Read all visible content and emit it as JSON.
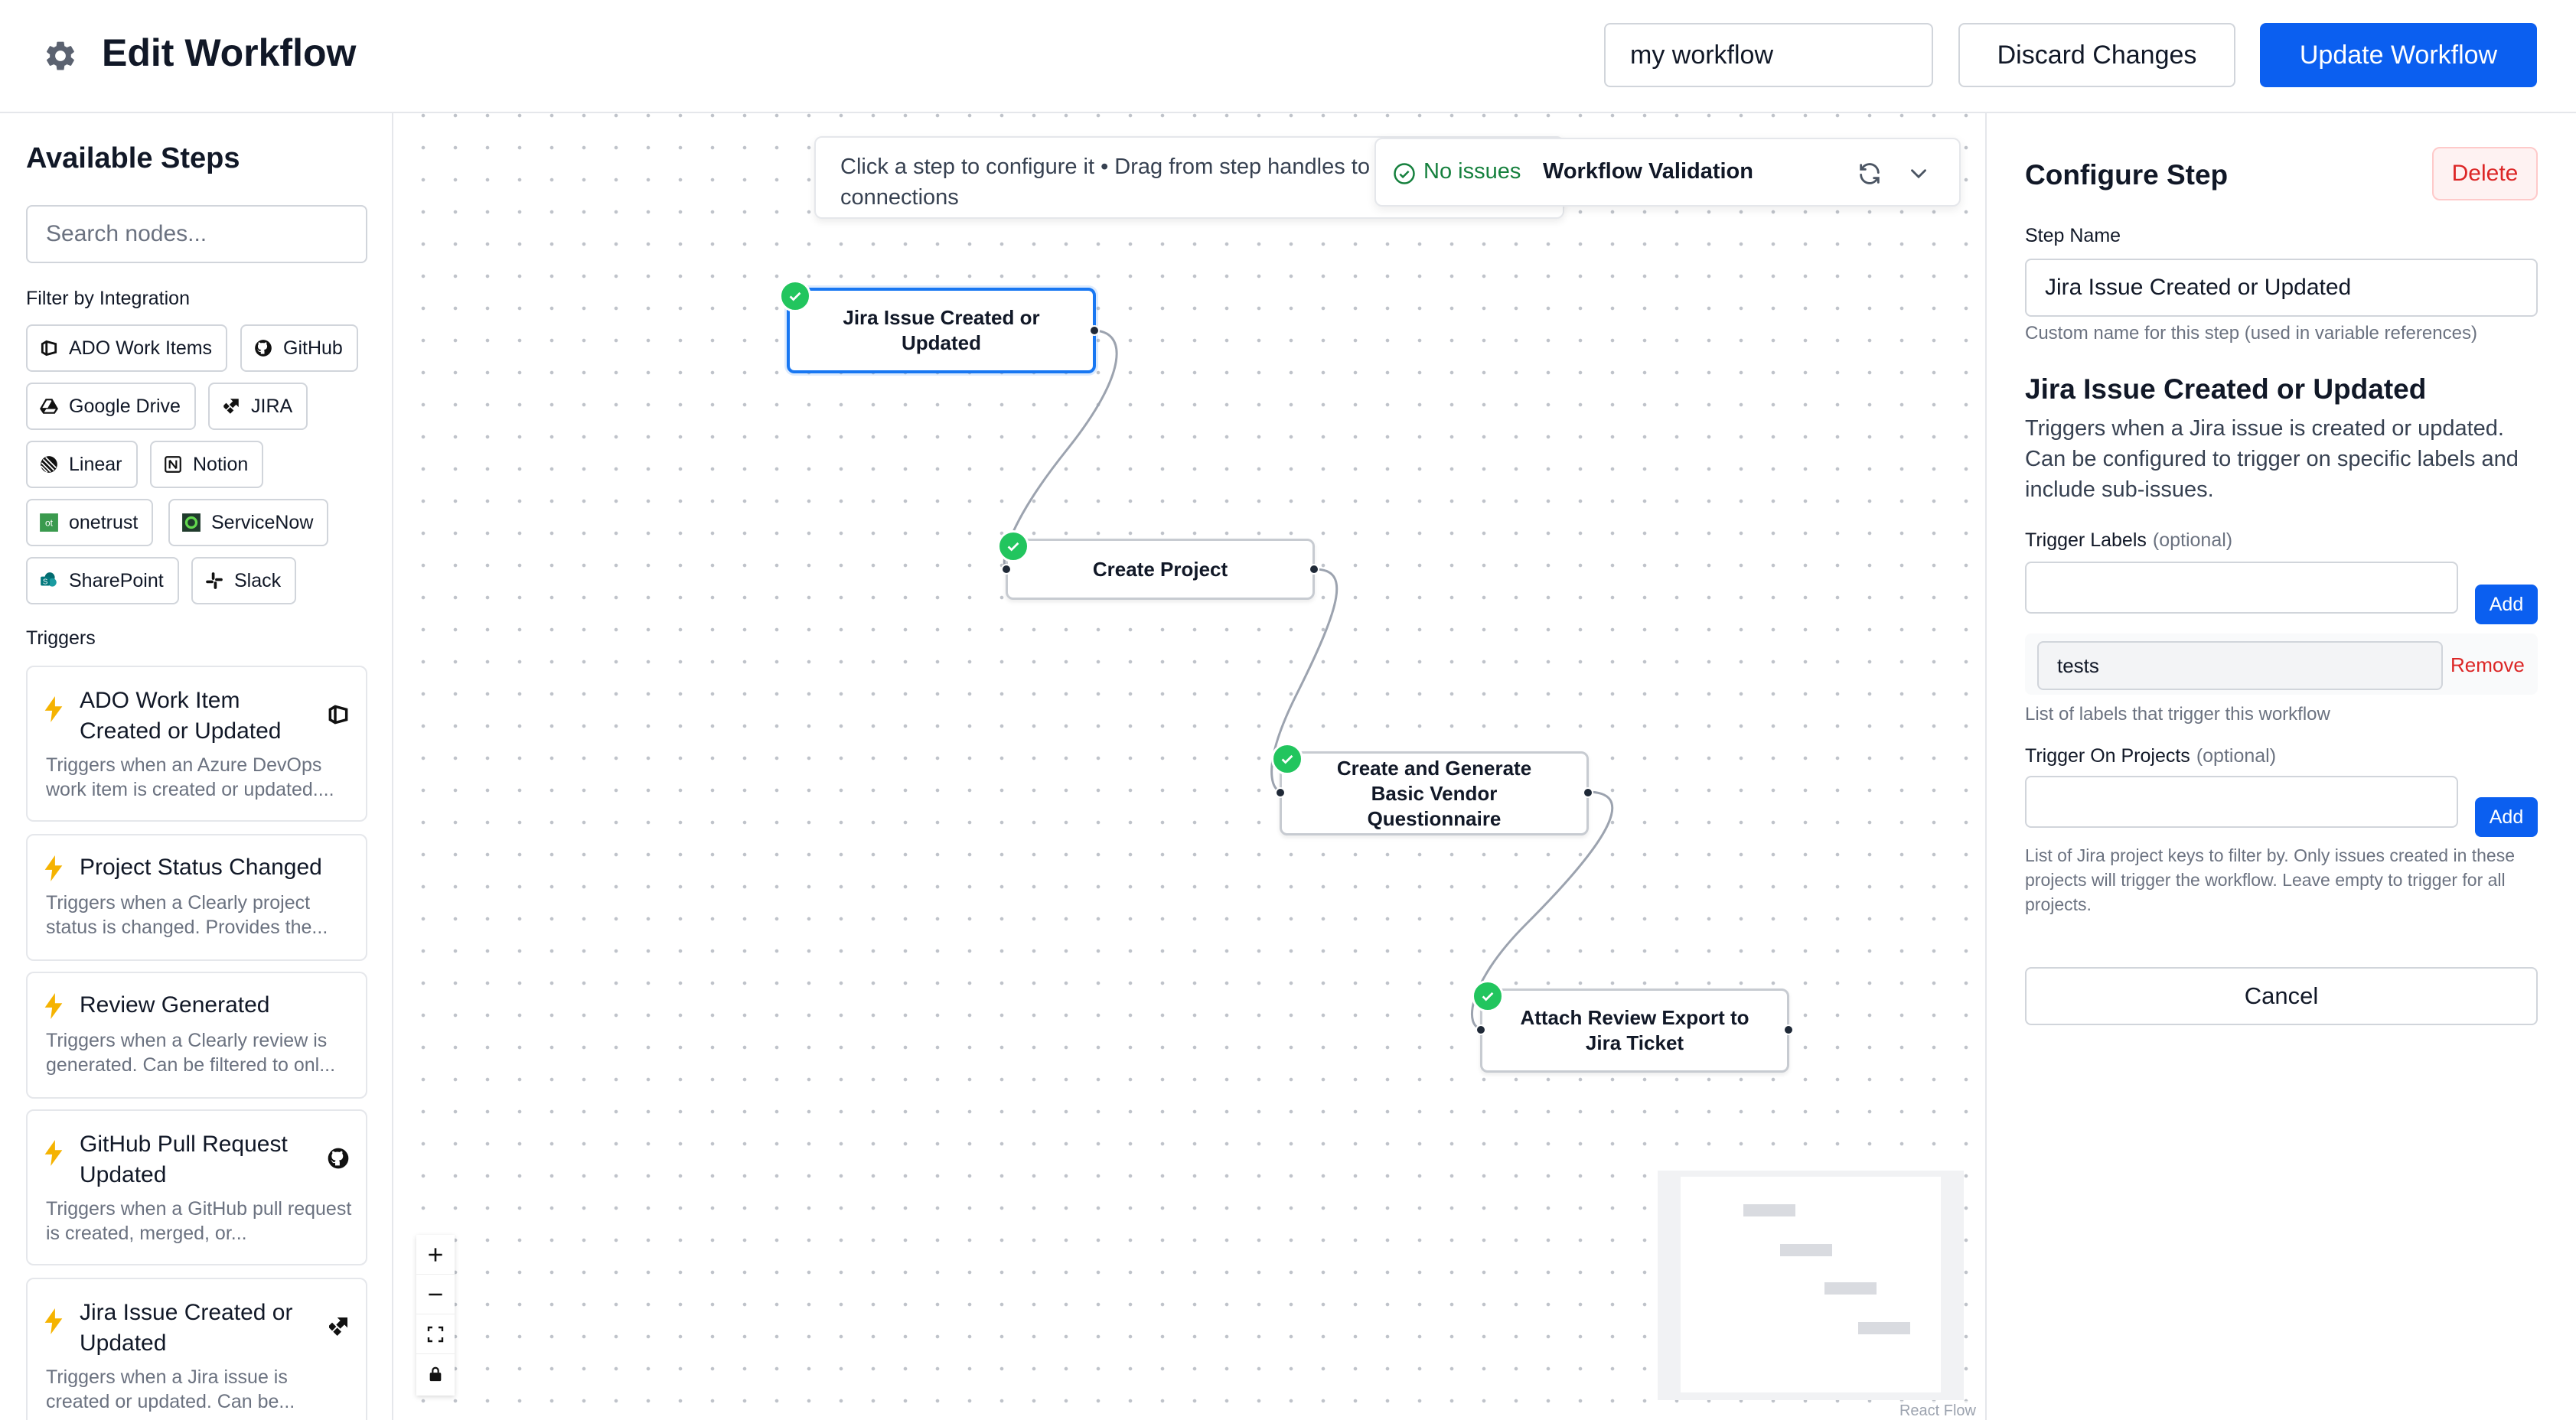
{
  "header": {
    "title": "Edit Workflow",
    "workflow_name": "my workflow",
    "discard_label": "Discard Changes",
    "update_label": "Update Workflow",
    "icon": "gear-icon"
  },
  "sidebar": {
    "title": "Available Steps",
    "search_placeholder": "Search nodes...",
    "filter_label": "Filter by Integration",
    "integrations": [
      {
        "label": "ADO Work Items",
        "icon": "azure-devops-icon"
      },
      {
        "label": "GitHub",
        "icon": "github-icon"
      },
      {
        "label": "Google Drive",
        "icon": "google-drive-icon"
      },
      {
        "label": "JIRA",
        "icon": "jira-icon"
      },
      {
        "label": "Linear",
        "icon": "linear-icon"
      },
      {
        "label": "Notion",
        "icon": "notion-icon"
      },
      {
        "label": "onetrust",
        "icon": "onetrust-icon"
      },
      {
        "label": "ServiceNow",
        "icon": "servicenow-icon"
      },
      {
        "label": "SharePoint",
        "icon": "sharepoint-icon"
      },
      {
        "label": "Slack",
        "icon": "slack-icon"
      }
    ],
    "triggers_label": "Triggers",
    "triggers": [
      {
        "title": "ADO Work Item Created or Updated",
        "desc": "Triggers when an Azure DevOps work item is created or updated....",
        "icon": "azure-devops-icon"
      },
      {
        "title": "Project Status Changed",
        "desc": "Triggers when a Clearly project status is changed. Provides the...",
        "icon": ""
      },
      {
        "title": "Review Generated",
        "desc": "Triggers when a Clearly review is generated. Can be filtered to onl...",
        "icon": ""
      },
      {
        "title": "GitHub Pull Request Updated",
        "desc": "Triggers when a GitHub pull request is created, merged, or...",
        "icon": "github-icon"
      },
      {
        "title": "Jira Issue Created or Updated",
        "desc": "Triggers when a Jira issue is created or updated. Can be...",
        "icon": "jira-icon"
      }
    ]
  },
  "canvas": {
    "hint": "Click a step to configure it • Drag from step handles to create connections",
    "validation": {
      "status": "No issues",
      "title": "Workflow Validation"
    },
    "nodes": [
      {
        "label": "Jira Issue Created or Updated",
        "selected": true,
        "valid": true
      },
      {
        "label": "Create Project",
        "selected": false,
        "valid": true
      },
      {
        "label": "Create and Generate Basic Vendor Questionnaire",
        "selected": false,
        "valid": true
      },
      {
        "label": "Attach Review Export to Jira Ticket",
        "selected": false,
        "valid": true
      }
    ],
    "attribution": "React Flow",
    "controls": [
      "zoom-in",
      "zoom-out",
      "fit-view",
      "lock"
    ]
  },
  "config": {
    "title": "Configure Step",
    "delete_label": "Delete",
    "step_name_label": "Step Name",
    "step_name_value": "Jira Issue Created or Updated",
    "step_name_help": "Custom name for this step (used in variable references)",
    "heading": "Jira Issue Created or Updated",
    "description": "Triggers when a Jira issue is created or updated. Can be configured to trigger on specific labels and include sub-issues.",
    "trigger_labels_label": "Trigger Labels",
    "optional": "(optional)",
    "add_label": "Add",
    "labels": [
      "tests"
    ],
    "remove_label": "Remove",
    "labels_help": "List of labels that trigger this workflow",
    "trigger_projects_label": "Trigger On Projects",
    "projects_help": "List of Jira project keys to filter by. Only issues created in these projects will trigger the workflow. Leave empty to trigger for all projects.",
    "cancel_label": "Cancel"
  },
  "colors": {
    "accent": "#0b5ff0",
    "success": "#22c55e",
    "danger": "#dc2626",
    "bolt": "#f5b301"
  }
}
